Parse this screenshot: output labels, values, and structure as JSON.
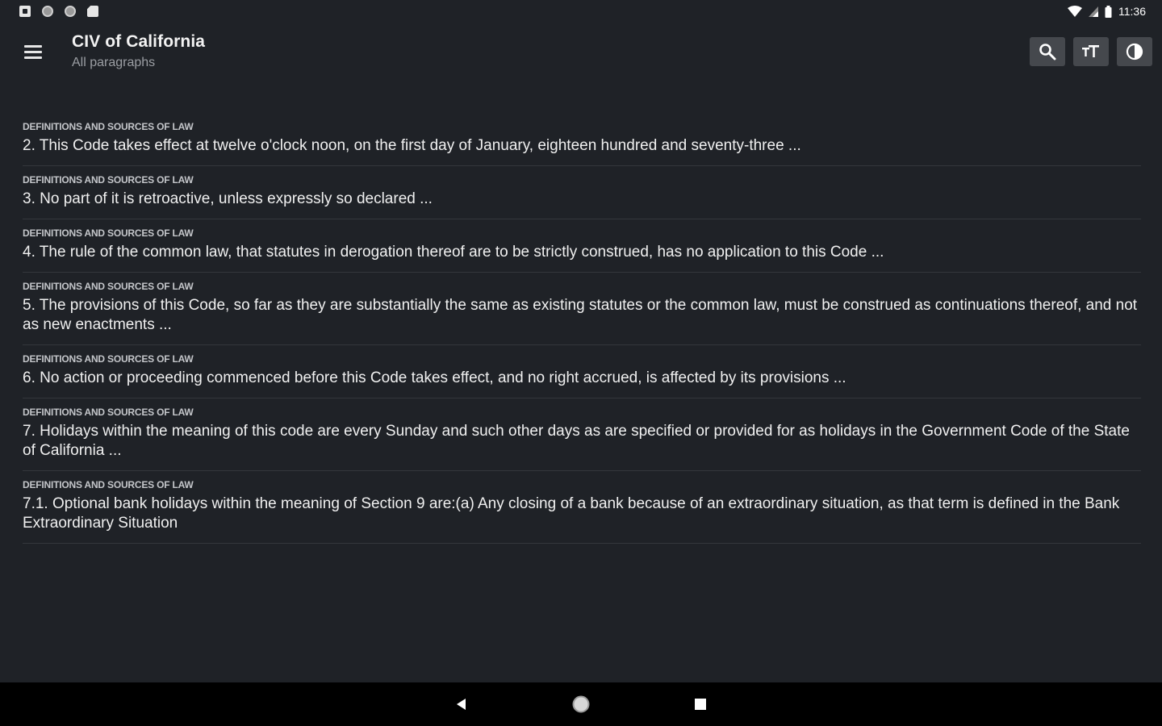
{
  "status_bar": {
    "time": "11:36",
    "left_icons": [
      "notification-square-icon",
      "circle-icon",
      "circle-icon",
      "sd-card-icon"
    ],
    "right_icons": [
      "wifi-icon",
      "signal-icon",
      "battery-icon"
    ]
  },
  "app_bar": {
    "title": "CIV of California",
    "subtitle": "All paragraphs",
    "actions": [
      "search-icon",
      "text-size-icon",
      "contrast-icon"
    ]
  },
  "items": [
    {
      "category": "DEFINITIONS AND SOURCES OF LAW",
      "text": "2. This Code takes effect at twelve o'clock noon, on the first day of January, eighteen hundred and seventy-three ..."
    },
    {
      "category": "DEFINITIONS AND SOURCES OF LAW",
      "text": "3. No part of it is retroactive, unless expressly so declared ..."
    },
    {
      "category": "DEFINITIONS AND SOURCES OF LAW",
      "text": "4. The rule of the common law, that statutes in derogation thereof are to be strictly construed, has no application to this Code ..."
    },
    {
      "category": "DEFINITIONS AND SOURCES OF LAW",
      "text": "5. The provisions of this Code, so far as they are substantially the same as existing statutes or the common law, must be construed as continuations thereof, and not as new enactments ..."
    },
    {
      "category": "DEFINITIONS AND SOURCES OF LAW",
      "text": "6. No action or proceeding commenced before this Code takes effect, and no right accrued, is affected by its provisions ..."
    },
    {
      "category": "DEFINITIONS AND SOURCES OF LAW",
      "text": "7. Holidays within the meaning of this code are every Sunday and such other days as are specified or provided for as holidays in the Government Code of the State of California ..."
    },
    {
      "category": "DEFINITIONS AND SOURCES OF LAW",
      "text": "7.1. Optional bank holidays within the meaning of Section 9 are:(a) Any closing of a bank because of an extraordinary situation, as that term is defined in the Bank Extraordinary Situation"
    }
  ],
  "nav_bar": {
    "buttons": [
      "back-icon",
      "home-icon",
      "recents-icon"
    ]
  }
}
